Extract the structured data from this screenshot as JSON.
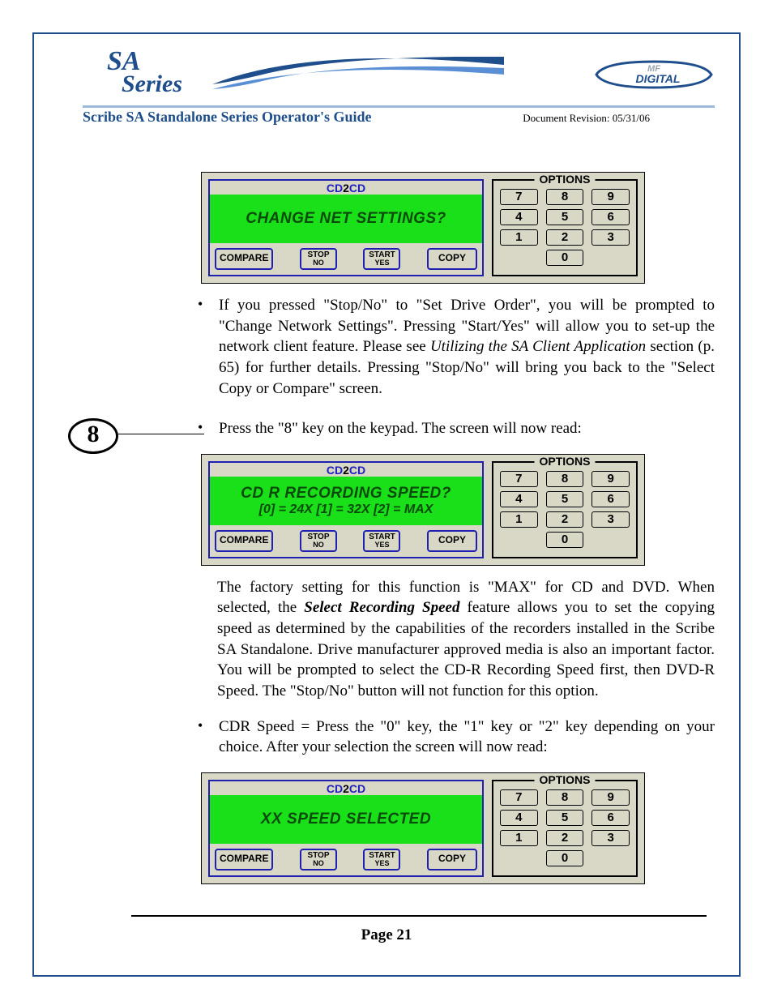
{
  "header": {
    "logo_top": "SA",
    "logo_bottom": "Series",
    "title": "Scribe SA Standalone Series Operator's Guide",
    "revision": "Document Revision: 05/31/06",
    "mf_top": "MF",
    "mf_bottom": "DIGITAL"
  },
  "panel_common": {
    "brand_left": "CD",
    "brand_mid": "2",
    "brand_right": "CD",
    "compare": "COMPARE",
    "stop_top": "STOP",
    "stop_sub": "NO",
    "start_top": "START",
    "start_sub": "YES",
    "copy": "COPY",
    "options": "OPTIONS",
    "keys": [
      "7",
      "8",
      "9",
      "4",
      "5",
      "6",
      "1",
      "2",
      "3"
    ],
    "zero": "0"
  },
  "panels": {
    "p1": {
      "lines": [
        "CHANGE NET SETTINGS?"
      ]
    },
    "p2": {
      "lines": [
        "CD R RECORDING SPEED?",
        "[0] = 24X [1] = 32X  [2] = MAX"
      ]
    },
    "p3": {
      "lines": [
        "XX SPEED SELECTED"
      ]
    }
  },
  "step": {
    "num": "8"
  },
  "bullets": {
    "b1a": "If you pressed \"Stop/No\" to \"Set Drive Order\", you will be prompted to \"Change Network Settings\".  Pressing \"Start/Yes\" will allow you to set-up the network client feature.  Please see ",
    "b1em": "Utilizing the SA Client Application",
    "b1b": " section (p. 65) for further details.  Pressing \"Stop/No\" will bring you back to the \"Select Copy or Compare\" screen.",
    "b2": "Press the \"8\" key on the keypad. The screen will now read:",
    "b3a": "The factory setting for this function is \"MAX\" for CD and DVD.  When selected, the ",
    "b3strong": "Select Recording Speed",
    "b3b": " feature allows you to set the copying speed as determined by the capabilities of the recorders installed in the Scribe SA Standalone. Drive manufacturer approved media is also an important factor.  You will be prompted to select the CD-R Recording Speed first, then DVD-R Speed. The \"Stop/No\" button will not function for this option.",
    "b4": "CDR Speed = Press the \"0\" key, the \"1\" key or \"2\" key depending on your choice. After your selection the screen will now read:"
  },
  "footer": {
    "page": "Page 21"
  }
}
